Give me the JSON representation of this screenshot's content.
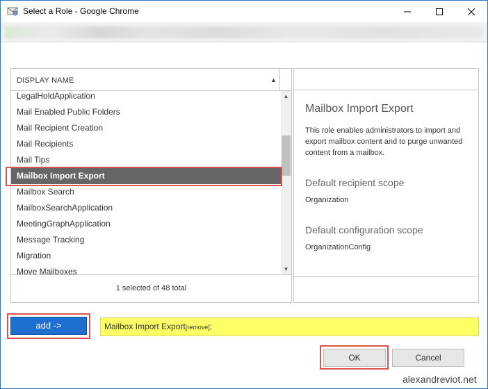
{
  "window": {
    "title": "Select a Role - Google Chrome",
    "minimize_icon": "minimize-icon",
    "maximize_icon": "maximize-icon",
    "close_icon": "close-icon"
  },
  "list": {
    "header": "DISPLAY NAME",
    "items": [
      "LegalHoldApplication",
      "Mail Enabled Public Folders",
      "Mail Recipient Creation",
      "Mail Recipients",
      "Mail Tips",
      "Mailbox Import Export",
      "Mailbox Search",
      "MailboxSearchApplication",
      "MeetingGraphApplication",
      "Message Tracking",
      "Migration",
      "Move Mailboxes"
    ],
    "selected_index": 5,
    "footer": "1 selected of 48 total"
  },
  "detail": {
    "title": "Mailbox Import Export",
    "description": "This role enables administrators to import and export mailbox content and to purge unwanted content from a mailbox.",
    "recipient_scope_label": "Default recipient scope",
    "recipient_scope_value": "Organization",
    "config_scope_label": "Default configuration scope",
    "config_scope_value": "OrganizationConfig"
  },
  "add": {
    "button_label": "add ->",
    "selected_text": "Mailbox Import Export",
    "remove_label": "[remove]",
    "suffix": ";"
  },
  "buttons": {
    "ok": "OK",
    "cancel": "Cancel"
  },
  "watermark": "alexandreviot.net",
  "colors": {
    "accent": "#1f6fd1",
    "highlight": "#d9534f",
    "selected_row": "#666666",
    "added_bg": "#ffff66"
  }
}
